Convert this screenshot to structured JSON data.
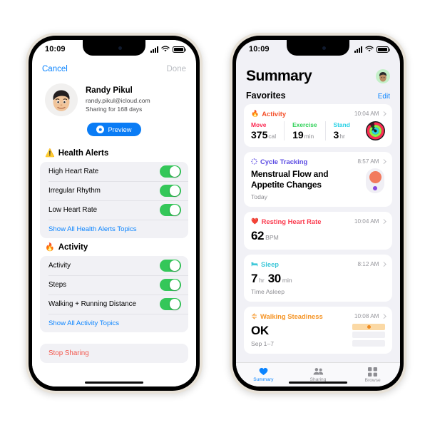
{
  "left_phone": {
    "status_bar": {
      "time": "10:09",
      "signal_icon": "cellular-bars-icon",
      "wifi_icon": "wifi-icon",
      "battery_icon": "battery-icon"
    },
    "nav": {
      "cancel": "Cancel",
      "done": "Done"
    },
    "profile": {
      "name": "Randy Pikul",
      "email": "randy.pikul@icloud.com",
      "sharing_duration": "Sharing for 168 days",
      "avatar_icon": "memoji-avatar"
    },
    "preview_button": {
      "label": "Preview",
      "icon": "eye-icon",
      "color": "#0a7cf5"
    },
    "sections": [
      {
        "icon": "warning-triangle-icon",
        "title": "Health Alerts",
        "rows": [
          {
            "label": "High Heart Rate",
            "toggle": "on"
          },
          {
            "label": "Irregular Rhythm",
            "toggle": "on"
          },
          {
            "label": "Low Heart Rate",
            "toggle": "on"
          }
        ],
        "link": "Show All Health Alerts Topics"
      },
      {
        "icon": "flame-icon",
        "title": "Activity",
        "rows": [
          {
            "label": "Activity",
            "toggle": "on"
          },
          {
            "label": "Steps",
            "toggle": "on"
          },
          {
            "label": "Walking + Running Distance",
            "toggle": "on"
          }
        ],
        "link": "Show All Activity Topics"
      }
    ],
    "stop_sharing": {
      "label": "Stop Sharing",
      "color": "#f2564c"
    }
  },
  "right_phone": {
    "status_bar": {
      "time": "10:09",
      "signal_icon": "cellular-bars-icon",
      "wifi_icon": "wifi-icon",
      "battery_icon": "battery-icon"
    },
    "header": {
      "title": "Summary",
      "avatar_icon": "memoji-avatar-small"
    },
    "favorites": {
      "label": "Favorites",
      "edit": "Edit"
    },
    "cards": {
      "activity": {
        "icon": "flame-icon",
        "title": "Activity",
        "title_color": "#f4502a",
        "time": "10:04 AM",
        "metrics": [
          {
            "label": "Move",
            "color": "#fb2c54",
            "value": "375",
            "unit": "cal"
          },
          {
            "label": "Exercise",
            "color": "#30d158",
            "value": "19",
            "unit": "min"
          },
          {
            "label": "Stand",
            "color": "#2ad2e6",
            "value": "3",
            "unit": "hr"
          }
        ],
        "rings_icon": "activity-rings-icon"
      },
      "cycle": {
        "icon": "cycle-tracking-icon",
        "title": "Cycle Tracking",
        "title_color": "#5a4ae3",
        "time": "8:57 AM",
        "headline": "Menstrual Flow and Appetite Changes",
        "subtitle": "Today",
        "graphic_icon": "cycle-flow-graphic"
      },
      "resting_hr": {
        "icon": "heart-icon",
        "title": "Resting Heart Rate",
        "title_color": "#fb3b4e",
        "time": "10:04 AM",
        "value": "62",
        "unit": "BPM"
      },
      "sleep": {
        "icon": "bed-icon",
        "title": "Sleep",
        "title_color": "#3fc8d9",
        "time": "8:12 AM",
        "hours": "7",
        "hours_unit": "hr",
        "minutes": "30",
        "minutes_unit": "min",
        "subtitle": "Time Asleep"
      },
      "walking_steadiness": {
        "icon": "walking-steadiness-icon",
        "title": "Walking Steadiness",
        "title_color": "#f59425",
        "time": "10:08 AM",
        "value": "OK",
        "subtitle": "Sep 1–7",
        "chart_icon": "steadiness-bars"
      }
    },
    "tabs": [
      {
        "label": "Summary",
        "icon": "heart-icon",
        "active": true
      },
      {
        "label": "Sharing",
        "icon": "people-icon",
        "active": false
      },
      {
        "label": "Browse",
        "icon": "grid-icon",
        "active": false
      }
    ]
  }
}
